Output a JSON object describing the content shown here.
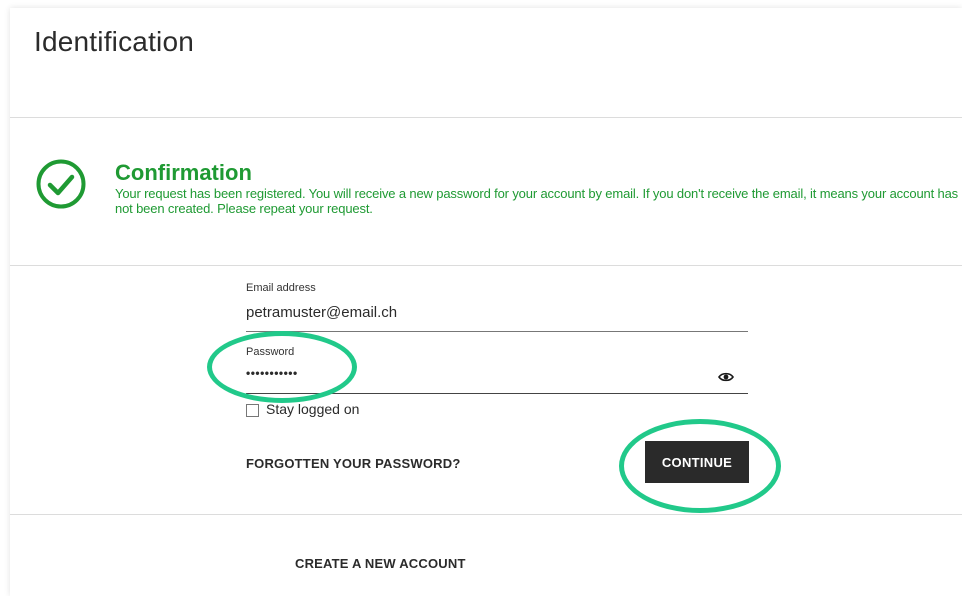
{
  "page": {
    "title": "Identification"
  },
  "confirmation": {
    "title": "Confirmation",
    "message": "Your request has been registered. You will receive a new password for your account by email. If you don't receive the email, it means your account has not been created. Please repeat your request.",
    "color": "#1f9a33",
    "icon": "check-circle-icon"
  },
  "form": {
    "email": {
      "label": "Email address",
      "value": "petramuster@email.ch"
    },
    "password": {
      "label": "Password",
      "value": "•••••••••••",
      "toggle_icon": "eye-icon"
    },
    "stay_logged_on": {
      "label": "Stay logged on",
      "checked": false
    },
    "forgot_link": "FORGOTTEN YOUR PASSWORD?",
    "continue_label": "CONTINUE"
  },
  "create_account_label": "CREATE A NEW ACCOUNT",
  "annotations": {
    "highlight_color": "#21c98a"
  }
}
